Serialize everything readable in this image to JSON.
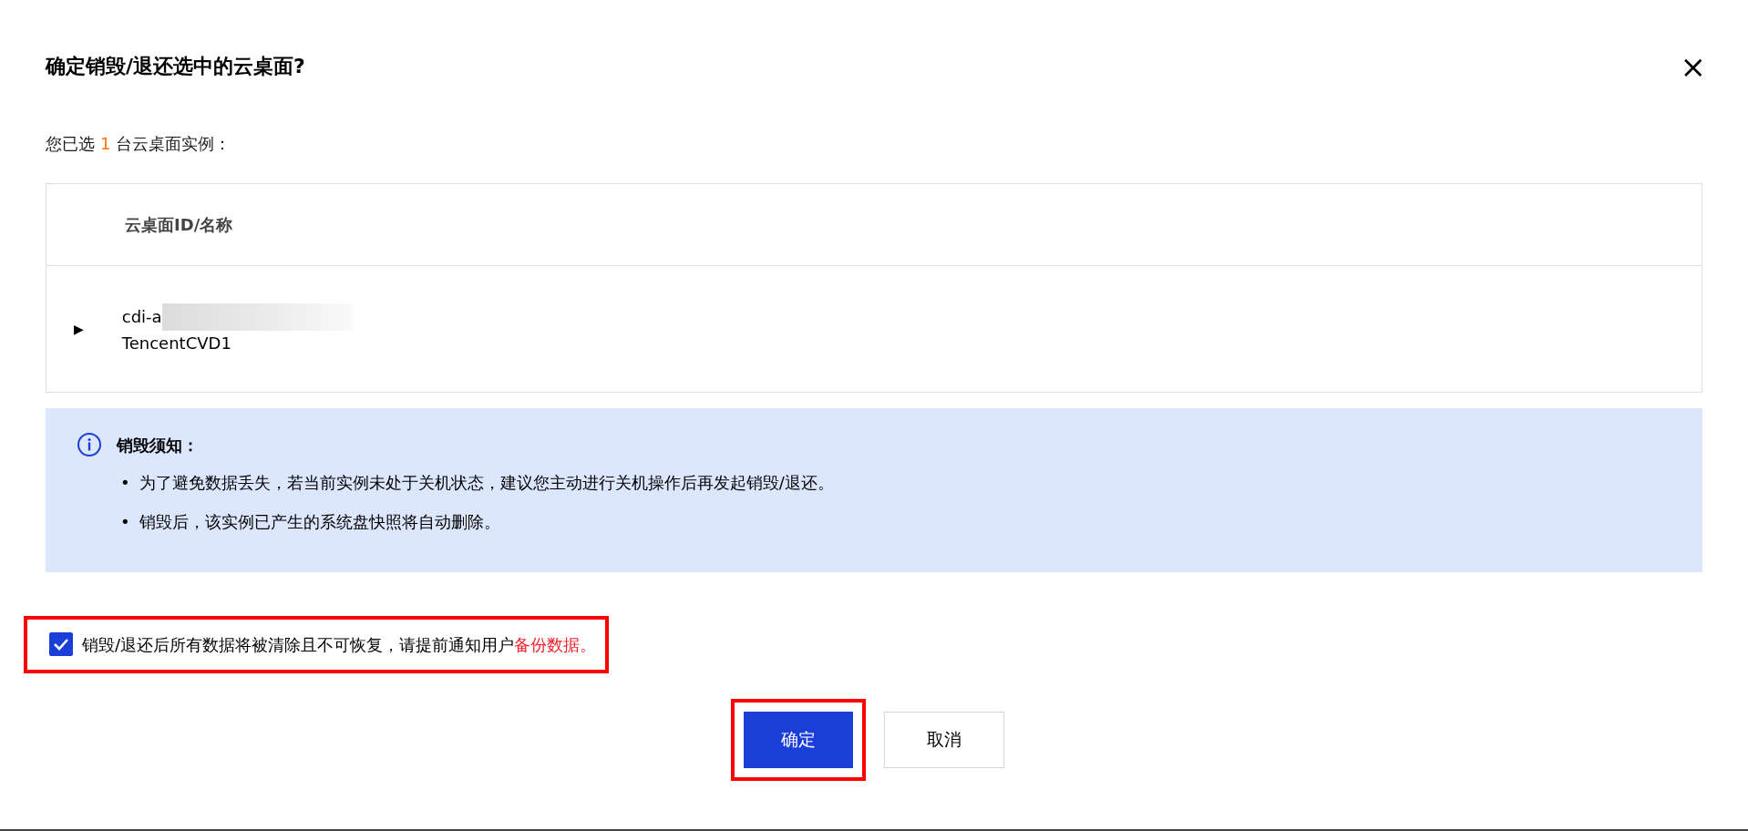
{
  "dialog": {
    "title": "确定销毁/退还选中的云桌面?",
    "close": "×"
  },
  "selection": {
    "prefix": "您已选",
    "count": "1",
    "suffix": "台云桌面实例："
  },
  "table": {
    "columns": [
      "云桌面ID/名称"
    ],
    "rows": [
      {
        "expanded": false,
        "toggle": "▶",
        "id": "cdi-a",
        "id_redacted": true,
        "name": "TencentCVD1"
      }
    ]
  },
  "notice": {
    "title": "销毁须知：",
    "items": [
      {
        "bullet": "•",
        "text": "为了避免数据丢失，若当前实例未处于关机状态，建议您主动进行关机操作后再发起销毁/退还。"
      },
      {
        "bullet": "•",
        "text": "销毁后，该实例已产生的系统盘快照将自动删除。"
      }
    ]
  },
  "agreement": {
    "checked": true,
    "highlighted": true,
    "text": "销毁/退还后所有数据将被清除且不可恢复，请提前通知用户",
    "link": "备份数据。"
  },
  "buttons": [
    {
      "label": "确定",
      "kind": "primary",
      "highlighted": true
    },
    {
      "label": "取消",
      "kind": "secondary",
      "highlighted": false
    }
  ]
}
